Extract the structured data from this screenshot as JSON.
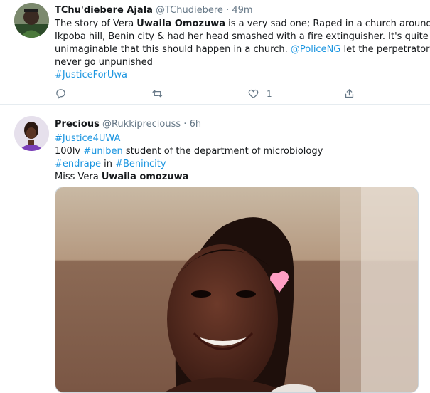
{
  "tweet1": {
    "display_name": "TChu'diebere Ajala",
    "handle": "@TChudiebere",
    "separator": "·",
    "time": "49m",
    "line1_a": "The story of Vera ",
    "line1_b": "Uwaila Omozuwa",
    "line1_c": " is a very sad one; Raped in a church around",
    "line2": "Ikpoba hill, Benin city & had her head smashed with a fire extinguisher. It's quite",
    "line3_a": "unimaginable that this should happen in a church. ",
    "line3_mention": "@PoliceNG",
    "line3_b": " let the perpetrators",
    "line4": "never go unpunished",
    "hashtag": "#JusticeForUwa",
    "like_count": "1"
  },
  "tweet2": {
    "display_name": "Precious",
    "handle": "@Rukkipreciouss",
    "separator": "·",
    "time": "6h",
    "hashtag1": "#Justice4UWA",
    "line2_a": "100lv ",
    "line2_tag": "#uniben",
    "line2_b": " student of the department of microbiology",
    "line3_tag1": "#endrape",
    "line3_mid": " in ",
    "line3_tag2": "#Benincity",
    "line4_a": "Miss Vera ",
    "line4_b": "Uwaila omozuwa"
  },
  "colors": {
    "link": "#1b95e0",
    "muted": "#657786",
    "divider": "#e6ecf0"
  },
  "icons": [
    "reply-icon",
    "retweet-icon",
    "like-icon",
    "share-icon"
  ]
}
